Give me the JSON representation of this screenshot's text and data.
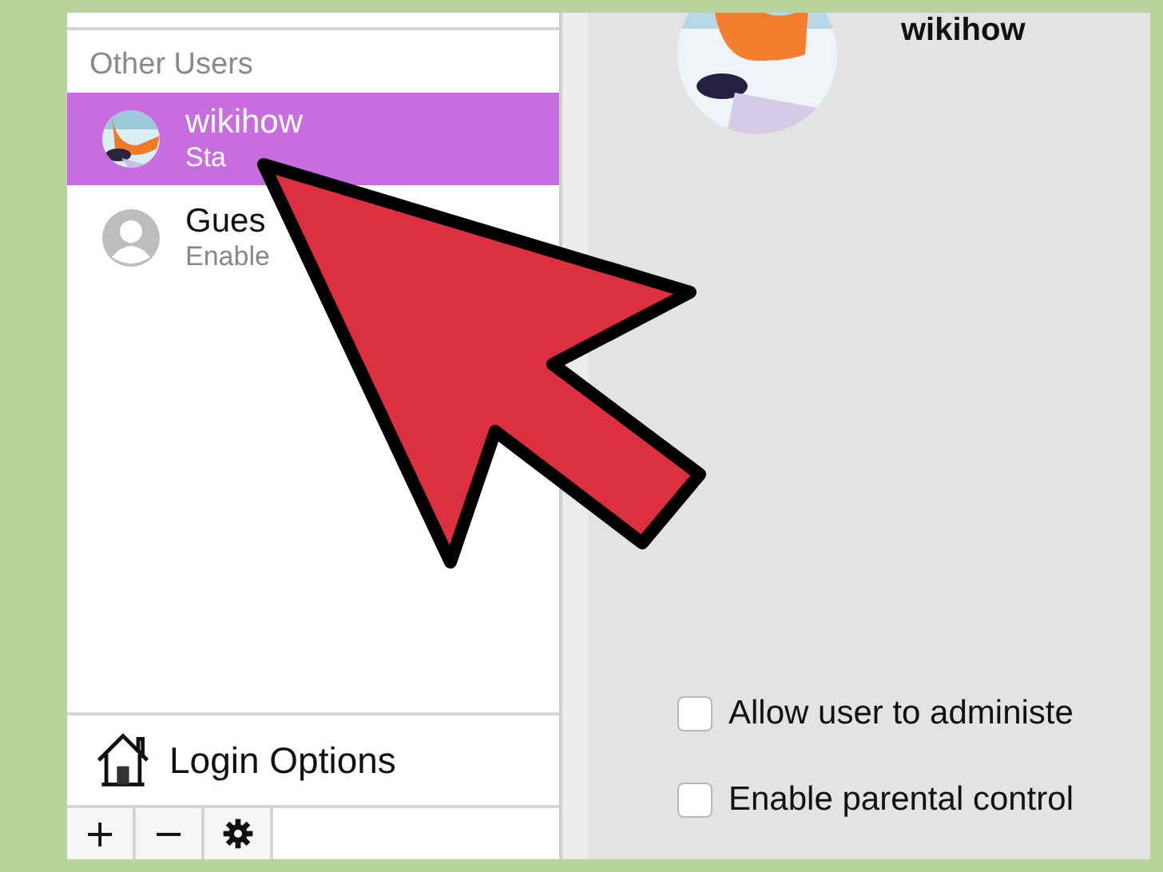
{
  "sidebar": {
    "section_header": "Other Users",
    "users": [
      {
        "name": "wikihow",
        "subtitle": "Sta",
        "kind": "picture",
        "selected": true
      },
      {
        "name": "Gues",
        "subtitle": "Enable",
        "kind": "silhouette",
        "selected": false
      }
    ],
    "login_options": "Login Options",
    "toolbar": [
      "+",
      "−"
    ]
  },
  "detail": {
    "user_name": "wikihow",
    "checkboxes": [
      {
        "label": "Allow user to administe",
        "checked": false
      },
      {
        "label": "Enable parental control",
        "checked": false
      }
    ]
  }
}
